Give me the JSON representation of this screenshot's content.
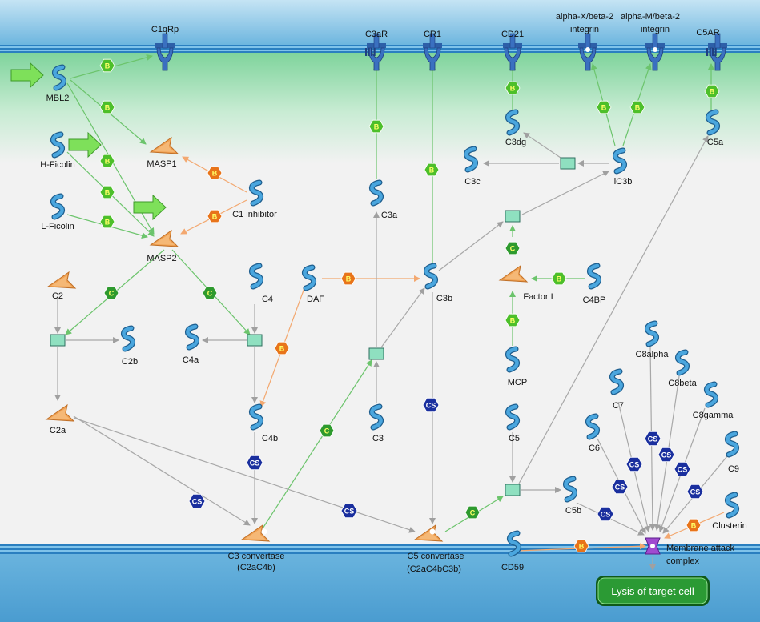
{
  "title": "",
  "nodes": {
    "C1qRp": "C1qRp",
    "C3aR": "C3aR",
    "CR1": "CR1",
    "CD21": "CD21",
    "alpha_x_l1": "alpha-X/beta-2",
    "alpha_x_l2": "integrin",
    "alpha_m_l1": "alpha-M/beta-2",
    "alpha_m_l2": "integrin",
    "C5AR": "C5AR",
    "MBL2": "MBL2",
    "H_Ficolin": "H-Ficolin",
    "L_Ficolin": "L-Ficolin",
    "MASP1": "MASP1",
    "MASP2": "MASP2",
    "C1_inhibitor": "C1 inhibitor",
    "C3a": "C3a",
    "C3dg": "C3dg",
    "C3c": "C3c",
    "iC3b": "iC3b",
    "C5a": "C5a",
    "C2": "C2",
    "C2b": "C2b",
    "C4": "C4",
    "C4a": "C4a",
    "DAF": "DAF",
    "C3b": "C3b",
    "Factor_I": "Factor I",
    "C4BP": "C4BP",
    "MCP": "MCP",
    "C2a": "C2a",
    "C4b": "C4b",
    "C3": "C3",
    "C5": "C5",
    "C5b": "C5b",
    "C8alpha": "C8alpha",
    "C8beta": "C8beta",
    "C8gamma": "C8gamma",
    "C7": "C7",
    "C6": "C6",
    "C9": "C9",
    "Clusterin": "Clusterin",
    "CD59": "CD59",
    "C3conv_l1": "C3 convertase",
    "C3conv_l2": "(C2aC4b)",
    "C5conv_l1": "C5 convertase",
    "C5conv_l2": "(C2aC4bC3b)",
    "MAC_l1": "Membrane attack",
    "MAC_l2": "complex"
  },
  "badges": {
    "binding": "B",
    "cleavage": "C",
    "complex_synthesis": "CS"
  },
  "outcome": "Lysis of target cell",
  "colors": {
    "membrane_fill": "#4aa3d6",
    "cytoplasm_green": "#8fdba3",
    "background": "#f2f2f2",
    "binding_badge": "#4dbf2a",
    "inhibit_badge": "#e8741a",
    "cleavage_badge": "#2e9a2e",
    "cs_badge": "#1a2f9e",
    "protein_blue": "#3a8fc8",
    "enzyme_orange": "#f0a050",
    "outcome_green": "#1f8a2a"
  }
}
